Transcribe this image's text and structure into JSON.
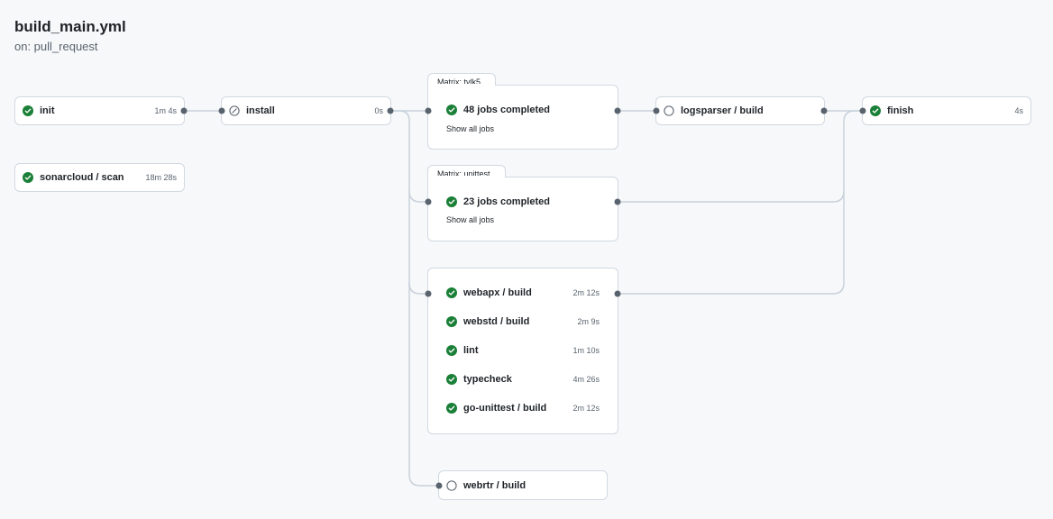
{
  "workflow": {
    "title": "build_main.yml",
    "trigger": "on: pull_request"
  },
  "colors": {
    "success": "#1a7f37",
    "neutral": "#59636e",
    "edge": "#c8d1da",
    "border": "#d1d9e0"
  },
  "jobs": {
    "init": {
      "name": "init",
      "duration": "1m 4s",
      "status": "success"
    },
    "sonarcloud": {
      "name": "sonarcloud / scan",
      "duration": "18m 28s",
      "status": "success"
    },
    "install": {
      "name": "install",
      "duration": "0s",
      "status": "skipped"
    },
    "logsparser": {
      "name": "logsparser / build",
      "status": "pending"
    },
    "finish": {
      "name": "finish",
      "duration": "4s",
      "status": "success"
    },
    "webrtr": {
      "name": "webrtr / build",
      "status": "pending"
    }
  },
  "matrices": {
    "tvlk5": {
      "label": "Matrix: tvlk5",
      "summary": "48 jobs completed",
      "show_all": "Show all jobs",
      "status": "success"
    },
    "unittest": {
      "label": "Matrix: unittest",
      "summary": "23 jobs completed",
      "show_all": "Show all jobs",
      "status": "success"
    }
  },
  "job_group": [
    {
      "name": "webapx / build",
      "duration": "2m 12s",
      "status": "success"
    },
    {
      "name": "webstd / build",
      "duration": "2m 9s",
      "status": "success"
    },
    {
      "name": "lint",
      "duration": "1m 10s",
      "status": "success"
    },
    {
      "name": "typecheck",
      "duration": "4m 26s",
      "status": "success"
    },
    {
      "name": "go-unittest / build",
      "duration": "2m 12s",
      "status": "success"
    }
  ]
}
